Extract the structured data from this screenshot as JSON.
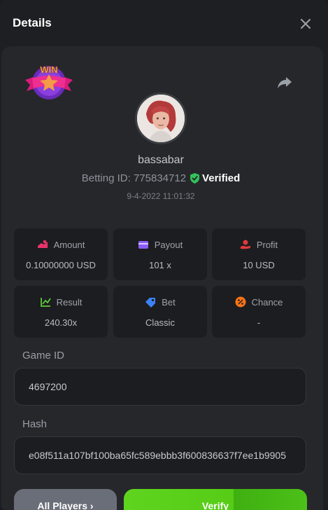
{
  "header": {
    "title": "Details"
  },
  "user": {
    "username": "bassabar",
    "betting_id_label": "Betting ID: 775834712",
    "verified_label": "Verified",
    "datetime": "9-4-2022 11:01:32"
  },
  "badge": {
    "text": "WIN"
  },
  "stats": {
    "amount": {
      "label": "Amount",
      "value": "0.10000000 USD"
    },
    "payout": {
      "label": "Payout",
      "value": "101 x"
    },
    "profit": {
      "label": "Profit",
      "value": "10 USD"
    },
    "result": {
      "label": "Result",
      "value": "240.30x"
    },
    "bet": {
      "label": "Bet",
      "value": "Classic"
    },
    "chance": {
      "label": "Chance",
      "value": "-"
    }
  },
  "game": {
    "label": "Game ID",
    "value": "4697200"
  },
  "hash": {
    "label": "Hash",
    "value": "e08f511a107bf100ba65fc589ebbb3f600836637f7ee1b9905"
  },
  "buttons": {
    "all_players": "All Players ›",
    "verify": "Verify"
  },
  "colors": {
    "accent_green": "#5fd41f",
    "verified_green": "#33c25a",
    "amount_icon": "#e8336b",
    "payout_icon": "#8b5cf6",
    "profit_icon": "#e03a3a",
    "result_icon": "#5fc93a",
    "bet_icon": "#3b82f6",
    "chance_icon": "#f97316"
  }
}
